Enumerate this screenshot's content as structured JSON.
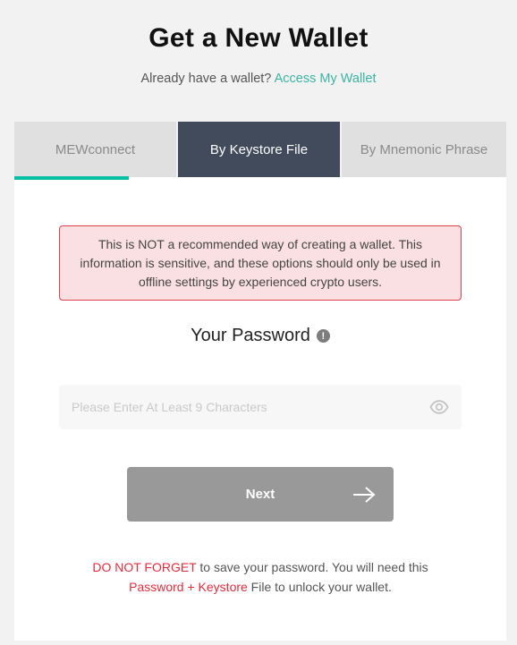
{
  "header": {
    "title": "Get a New Wallet",
    "subtitle_prefix": "Already have a wallet?",
    "access_link": "Access My Wallet"
  },
  "tabs": [
    {
      "label": "MEWconnect",
      "active": false
    },
    {
      "label": "By Keystore File",
      "active": true
    },
    {
      "label": "By Mnemonic Phrase",
      "active": false
    }
  ],
  "warning": {
    "text": "This is NOT a recommended way of creating a wallet. This information is sensitive, and these options should only be used in offline settings by experienced crypto users."
  },
  "password": {
    "title": "Your Password",
    "info_icon": "!",
    "placeholder": "Please Enter At Least 9 Characters",
    "value": ""
  },
  "next_button": {
    "label": "Next",
    "arrow": "→"
  },
  "note": {
    "red1": "DO NOT FORGET",
    "text1": " to save your password. You will need this",
    "red2": "Password + Keystore",
    "text2": " File to unlock your wallet."
  },
  "colors": {
    "accent": "#05c0a5",
    "link": "#3cb4a5",
    "active_tab": "#414b5c",
    "warning_border": "#e0414f",
    "warning_bg": "#fbe0e3",
    "danger_text": "#e52b3c",
    "button_disabled": "#999999"
  }
}
